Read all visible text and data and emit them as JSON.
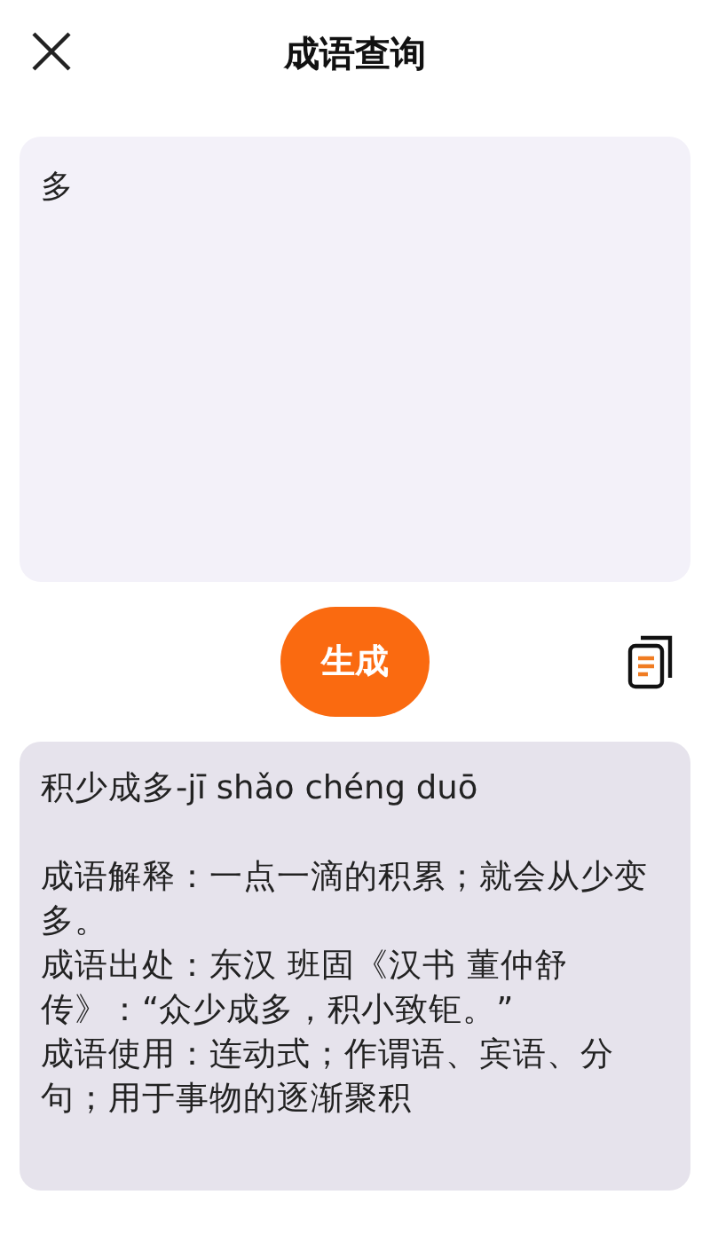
{
  "header": {
    "title": "成语查询"
  },
  "input": {
    "value": "多"
  },
  "generate_button": {
    "label": "生成"
  },
  "result": {
    "lines": [
      "积少成多-jī shǎo chéng duō",
      "成语解释：一点一滴的积累；就会从少变多。",
      "成语出处：东汉 班固《汉书 董仲舒传》：“众少成多，积小致钜。”",
      "成语使用：连动式；作谓语、宾语、分句；用于事物的逐渐聚积"
    ]
  }
}
